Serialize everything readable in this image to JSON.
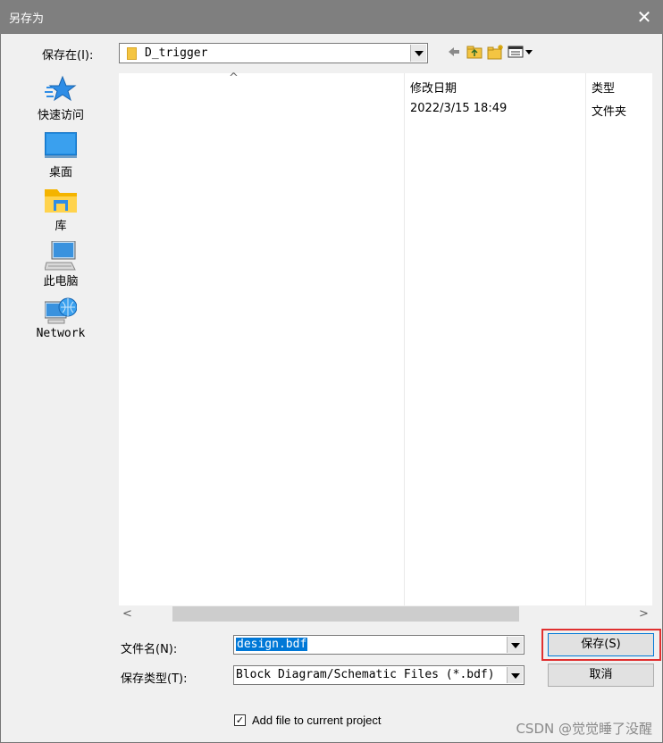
{
  "window": {
    "title": "另存为",
    "close_glyph": "✕"
  },
  "location": {
    "label": "保存在(I):",
    "value": "D_trigger"
  },
  "toolbar": {
    "back_glyph": "🡐",
    "view_glyph": "▾"
  },
  "places": [
    {
      "label": "快速访问",
      "icon": "star-icon"
    },
    {
      "label": "桌面",
      "icon": "desktop-icon"
    },
    {
      "label": "库",
      "icon": "library-icon"
    },
    {
      "label": "此电脑",
      "icon": "computer-icon"
    },
    {
      "label": "Network",
      "icon": "network-icon"
    }
  ],
  "filelist": {
    "sort_glyph": "^",
    "columns": {
      "modified": "修改日期",
      "type": "类型"
    },
    "row": {
      "modified": "2022/3/15 18:49",
      "type": "文件夹"
    }
  },
  "scrollbar": {
    "left": "<",
    "right": ">"
  },
  "filename": {
    "label": "文件名(N):",
    "value": "design.bdf"
  },
  "filetype": {
    "label": "保存类型(T):",
    "value": "Block Diagram/Schematic Files (*.bdf)"
  },
  "buttons": {
    "save": "保存(S)",
    "cancel": "取消"
  },
  "checkbox": {
    "label": "Add file to current project",
    "checked": true,
    "mark": "✓"
  },
  "watermark": "CSDN @觉觉睡了没醒",
  "colors": {
    "selection": "#0078d7",
    "highlight_box": "#e03030",
    "titlebar": "#7f7f7f"
  }
}
